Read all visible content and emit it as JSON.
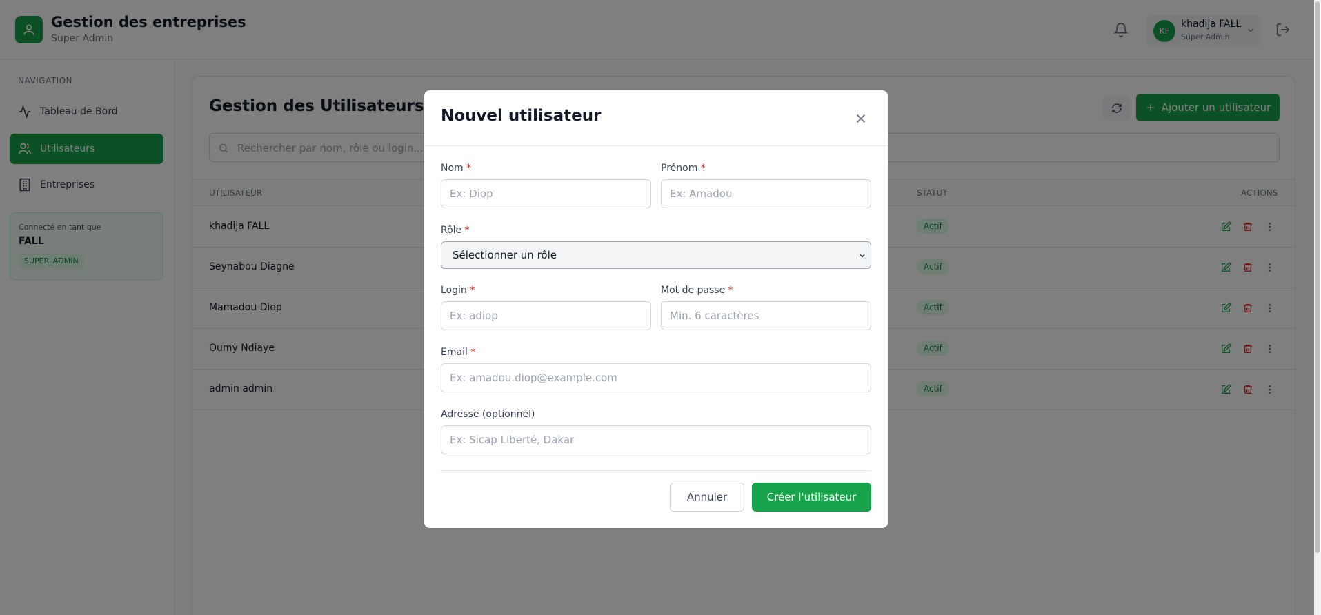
{
  "header": {
    "app_title": "Gestion des entreprises",
    "app_subtitle": "Super Admin",
    "user": {
      "initials": "KF",
      "name": "khadija FALL",
      "role": "Super Admin"
    }
  },
  "sidebar": {
    "section_title": "NAVIGATION",
    "items": [
      {
        "label": "Tableau de Bord",
        "icon": "activity-icon"
      },
      {
        "label": "Utilisateurs",
        "icon": "users-icon",
        "active": true
      },
      {
        "label": "Entreprises",
        "icon": "building-icon"
      }
    ],
    "connected": {
      "label": "Connecté en tant que",
      "name": "FALL",
      "badge": "SUPER_ADMIN"
    }
  },
  "main": {
    "title": "Gestion des Utilisateurs",
    "add_button": "Ajouter un utilisateur",
    "search_placeholder": "Rechercher par nom, rôle ou login...",
    "columns": {
      "user": "UTILISATEUR",
      "status": "STATUT",
      "actions": "ACTIONS"
    },
    "rows": [
      {
        "name": "khadija FALL",
        "status": "Actif"
      },
      {
        "name": "Seynabou Diagne",
        "status": "Actif"
      },
      {
        "name": "Mamadou Diop",
        "status": "Actif"
      },
      {
        "name": "Oumy Ndiaye",
        "status": "Actif"
      },
      {
        "name": "admin admin",
        "status": "Actif"
      }
    ]
  },
  "modal": {
    "title": "Nouvel utilisateur",
    "fields": {
      "nom": {
        "label": "Nom",
        "required": "*",
        "placeholder": "Ex: Diop"
      },
      "prenom": {
        "label": "Prénom",
        "required": "*",
        "placeholder": "Ex: Amadou"
      },
      "role": {
        "label": "Rôle",
        "required": "*",
        "selected": "Sélectionner un rôle"
      },
      "login": {
        "label": "Login",
        "required": "*",
        "placeholder": "Ex: adiop"
      },
      "password": {
        "label": "Mot de passe",
        "required": "*",
        "placeholder": "Min. 6 caractères"
      },
      "email": {
        "label": "Email",
        "required": "*",
        "placeholder": "Ex: amadou.diop@example.com"
      },
      "adresse": {
        "label": "Adresse (optionnel)",
        "placeholder": "Ex: Sicap Liberté, Dakar"
      }
    },
    "cancel_label": "Annuler",
    "submit_label": "Créer l'utilisateur"
  },
  "colors": {
    "accent": "#16a34a",
    "danger": "#dc2626",
    "badge_bg": "#dcfce7"
  }
}
